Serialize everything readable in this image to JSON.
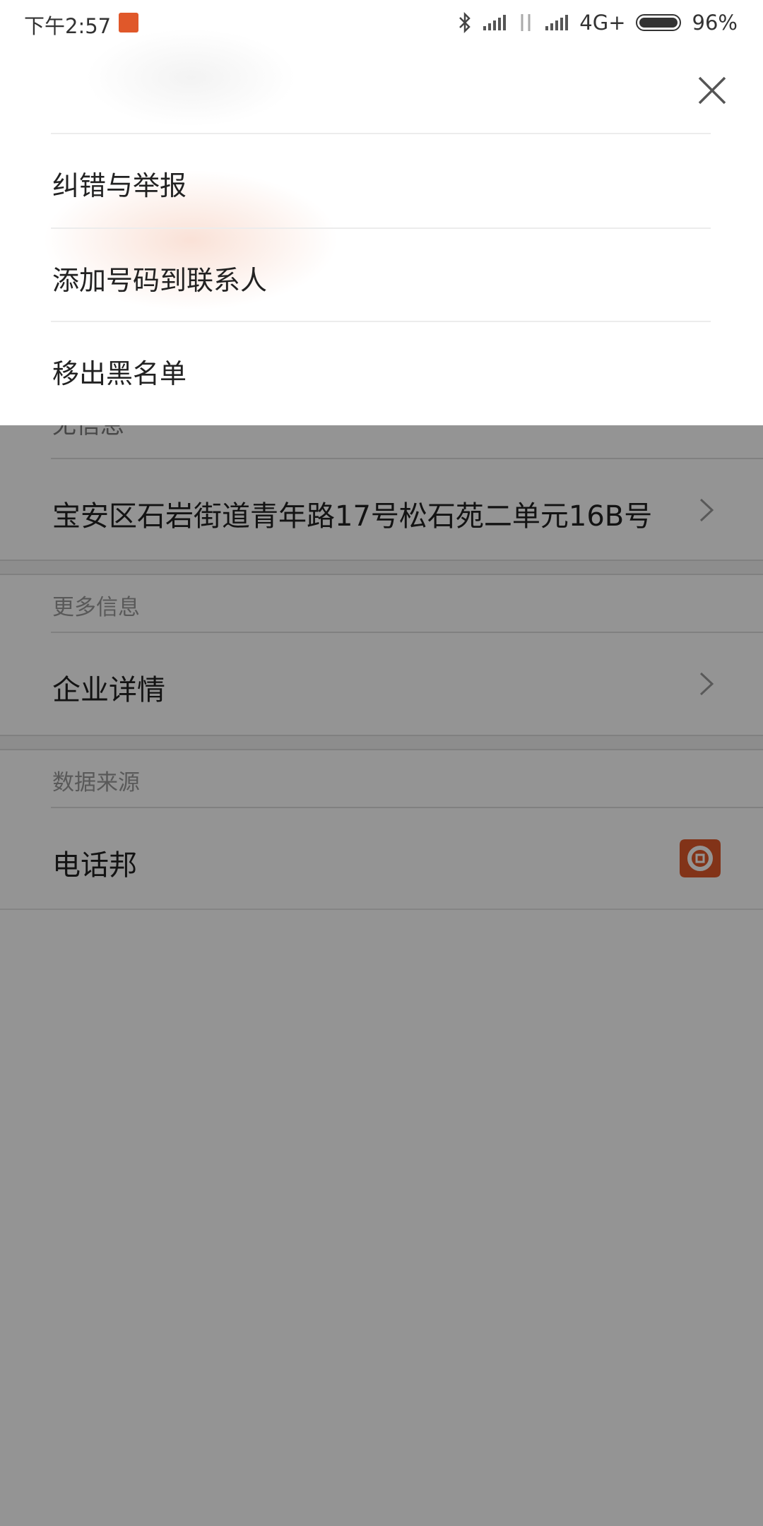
{
  "status_bar": {
    "time": "下午2:57",
    "network": "4G+",
    "battery": "96%",
    "icons": [
      "bluetooth-icon",
      "signal-icon",
      "data-arrows-icon",
      "signal-icon",
      "battery-icon"
    ]
  },
  "sheet": {
    "menu": [
      {
        "label": "纠错与举报"
      },
      {
        "label": "添加号码到联系人"
      },
      {
        "label": "移出黑名单"
      }
    ]
  },
  "background": {
    "partial_label": "无信息",
    "address": "宝安区石岩街道青年路17号松石苑二单元16B号",
    "more_info_title": "更多信息",
    "company_details": "企业详情",
    "data_source_title": "数据来源",
    "data_source": "电话邦"
  },
  "colors": {
    "accent": "#e0582a",
    "overlay": "rgba(0,0,0,0.42)"
  }
}
